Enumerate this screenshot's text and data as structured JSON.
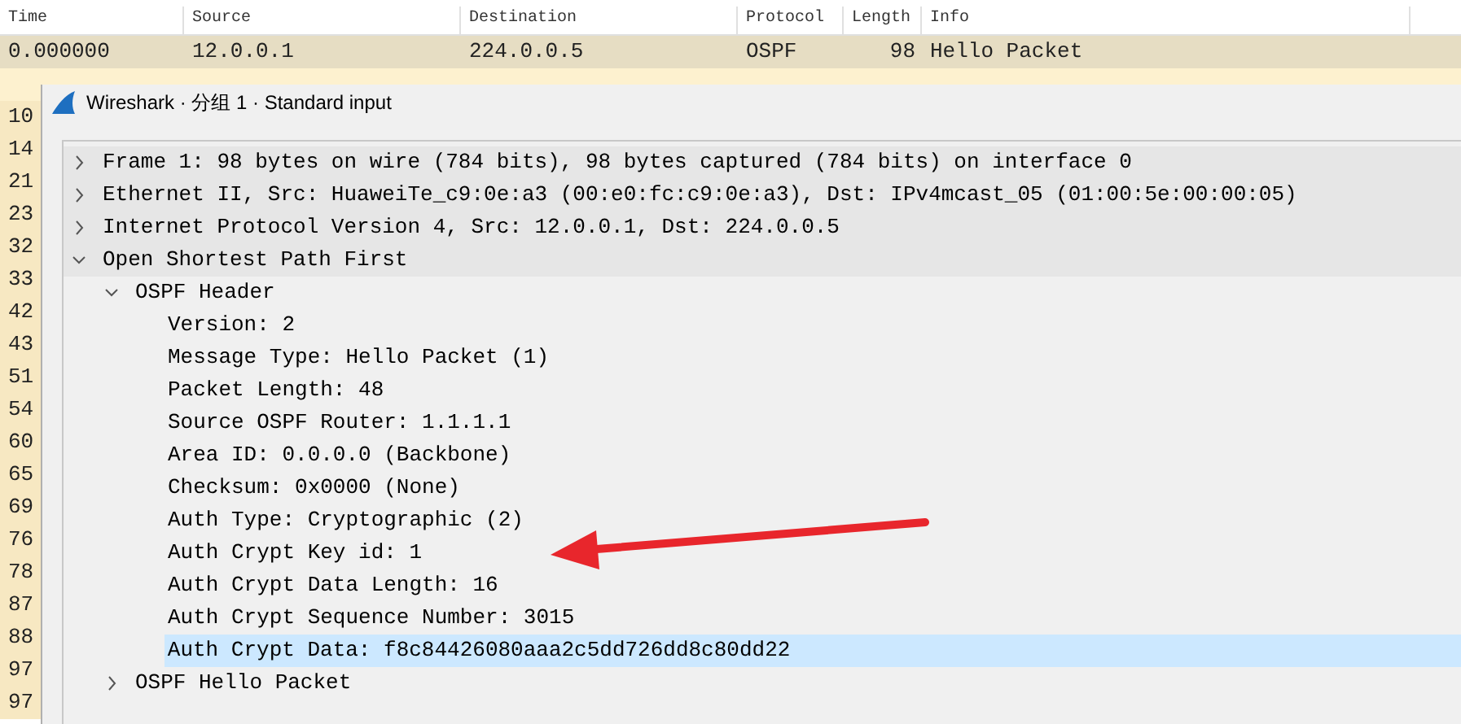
{
  "packet_list": {
    "columns": [
      "Time",
      "Source",
      "Destination",
      "Protocol",
      "Length",
      "Info"
    ],
    "rows": [
      {
        "cells": [
          "0.000000",
          "12.0.0.1",
          "224.0.0.5",
          "OSPF",
          "98",
          "Hello Packet"
        ],
        "selected": true
      },
      {
        "selected": false
      },
      {
        "cells": [
          "10"
        ],
        "selected": false
      },
      {
        "cells": [
          "14"
        ],
        "selected": false
      },
      {
        "cells": [
          "21"
        ],
        "selected": false
      },
      {
        "cells": [
          "23"
        ],
        "selected": false
      },
      {
        "cells": [
          "32"
        ],
        "selected": false
      },
      {
        "cells": [
          "33"
        ],
        "selected": false
      },
      {
        "cells": [
          "42"
        ],
        "selected": false
      },
      {
        "cells": [
          "43"
        ],
        "selected": false
      },
      {
        "cells": [
          "51"
        ],
        "selected": false
      },
      {
        "cells": [
          "54"
        ],
        "selected": false
      },
      {
        "cells": [
          "60"
        ],
        "selected": false
      },
      {
        "cells": [
          "65"
        ],
        "selected": false
      },
      {
        "cells": [
          "69"
        ],
        "selected": false
      },
      {
        "cells": [
          "76"
        ],
        "selected": false
      },
      {
        "cells": [
          "78"
        ],
        "selected": false
      },
      {
        "cells": [
          "87"
        ],
        "selected": false
      },
      {
        "cells": [
          "88"
        ],
        "selected": false
      },
      {
        "cells": [
          "97"
        ],
        "selected": false
      },
      {
        "cells": [
          "97"
        ],
        "selected": false
      }
    ]
  },
  "dialog": {
    "title": "Wireshark · 分组 1 · Standard input",
    "tree": [
      {
        "label": "Frame 1: 98 bytes on wire (784 bits), 98 bytes captured (784 bits) on interface 0",
        "expanded": false,
        "selected": false
      },
      {
        "label": "Ethernet II, Src: HuaweiTe_c9:0e:a3 (00:e0:fc:c9:0e:a3), Dst: IPv4mcast_05 (01:00:5e:00:00:05)",
        "expanded": false,
        "selected": false
      },
      {
        "label": "Internet Protocol Version 4, Src: 12.0.0.1, Dst: 224.0.0.5",
        "expanded": false,
        "selected": false
      },
      {
        "label": "Open Shortest Path First",
        "expanded": true,
        "selected": false,
        "children": [
          {
            "label": "OSPF Header",
            "expanded": true,
            "selected": false,
            "children": [
              {
                "label": "Version: 2",
                "selected": false
              },
              {
                "label": "Message Type: Hello Packet (1)",
                "selected": false
              },
              {
                "label": "Packet Length: 48",
                "selected": false
              },
              {
                "label": "Source OSPF Router: 1.1.1.1",
                "selected": false
              },
              {
                "label": "Area ID: 0.0.0.0 (Backbone)",
                "selected": false
              },
              {
                "label": "Checksum: 0x0000 (None)",
                "selected": false
              },
              {
                "label": "Auth Type: Cryptographic (2)",
                "selected": false
              },
              {
                "label": "Auth Crypt Key id: 1",
                "selected": false
              },
              {
                "label": "Auth Crypt Data Length: 16",
                "selected": false
              },
              {
                "label": "Auth Crypt Sequence Number: 3015",
                "selected": false
              },
              {
                "label": "Auth Crypt Data: f8c84426080aaa2c5dd726dd8c80dd22",
                "selected": true
              }
            ]
          },
          {
            "label": "OSPF Hello Packet",
            "expanded": false,
            "selected": false
          }
        ]
      }
    ]
  }
}
